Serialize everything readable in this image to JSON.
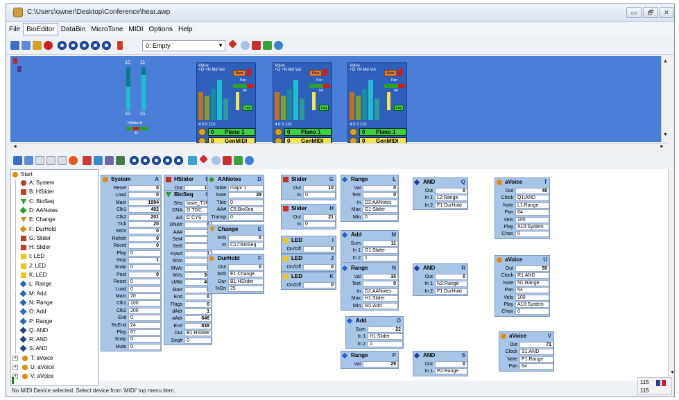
{
  "window": {
    "title": "C:\\Users\\owner\\Desktop\\Conference\\hear.awp",
    "min": "▭",
    "max": "🗗",
    "close": "✕"
  },
  "menu": [
    "File",
    "BioEditor",
    "DataBin",
    "MicroTone",
    "MIDI",
    "Options",
    "Help"
  ],
  "toolbar": {
    "preset": "0: Empty"
  },
  "rack": {
    "hslider": {
      "top_a": "10",
      "top_b": "11",
      "mid_a": "10",
      "mid_b": "21",
      "label": "HSlider H",
      "sub": "11",
      "levels": [
        0.55,
        0.82
      ]
    },
    "voices": [
      {
        "title": "Voice",
        "sub": "+O +N Md Vol",
        "mute": "Mute",
        "pan": "Pan",
        "pan_val": "64",
        "leg": "Leg",
        "nums": "4   0   0  110",
        "instrument_num": "0",
        "instrument": "Piano 1",
        "bank_num": "0",
        "bank": "GenMIDI"
      },
      {
        "title": "Voice",
        "sub": "+O +N Md Vol",
        "mute": "Mute",
        "pan": "Pan",
        "pan_val": "64",
        "leg": "Leg",
        "nums": "4   0   0  110",
        "instrument_num": "0",
        "instrument": "Piano 1",
        "bank_num": "0",
        "bank": "GenMIDI"
      },
      {
        "title": "Voice",
        "sub": "+O +N Md Vol",
        "mute": "Mute",
        "pan": "Pan",
        "pan_val": "64",
        "leg": "Leg",
        "nums": "4   0   0  110",
        "instrument_num": "0",
        "instrument": "Piano 1",
        "bank_num": "0",
        "bank": "GenMIDI"
      }
    ]
  },
  "tree": {
    "root": "Start",
    "items": [
      {
        "label": "A: System",
        "shape": "dot",
        "color": "#c0392b"
      },
      {
        "label": "B: HSlider",
        "shape": "sq",
        "color": "#c0392b"
      },
      {
        "label": "C: BioSeq",
        "shape": "tri",
        "color": "#2aa02a"
      },
      {
        "label": "D: AANotes",
        "shape": "dia",
        "color": "#2aa02a"
      },
      {
        "label": "E: Change",
        "shape": "tri",
        "color": "#e08a1a"
      },
      {
        "label": "F: DurHold",
        "shape": "dia",
        "color": "#e08a1a"
      },
      {
        "label": "G: Slider",
        "shape": "sq",
        "color": "#c0392b"
      },
      {
        "label": "H: Slider",
        "shape": "sq",
        "color": "#c0392b"
      },
      {
        "label": "I: LED",
        "shape": "sq",
        "color": "#e8c820"
      },
      {
        "label": "J: LED",
        "shape": "sq",
        "color": "#e8c820"
      },
      {
        "label": "K: LED",
        "shape": "sq",
        "color": "#e8c820"
      },
      {
        "label": "L: Range",
        "shape": "dia",
        "color": "#2a62c8"
      },
      {
        "label": "M: Add",
        "shape": "dia",
        "color": "#2a62c8"
      },
      {
        "label": "N: Range",
        "shape": "dia",
        "color": "#2a62c8"
      },
      {
        "label": "O: Add",
        "shape": "dia",
        "color": "#2a62c8"
      },
      {
        "label": "P: Range",
        "shape": "dia",
        "color": "#2a62c8"
      },
      {
        "label": "Q: AND",
        "shape": "dia",
        "color": "#1f3f9a"
      },
      {
        "label": "R: AND",
        "shape": "dia",
        "color": "#1f3f9a"
      },
      {
        "label": "S: AND",
        "shape": "dia",
        "color": "#1f3f9a"
      },
      {
        "label": "T: aVoice",
        "shape": "dot",
        "color": "#e08a1a",
        "expand": "+"
      },
      {
        "label": "U: aVoice",
        "shape": "dot",
        "color": "#e08a1a",
        "expand": "+"
      },
      {
        "label": "V: aVoice",
        "shape": "dot",
        "color": "#e08a1a",
        "expand": "+"
      }
    ]
  },
  "blocks": {
    "system": {
      "title": "System",
      "letter": "A",
      "rows": [
        [
          "Reset",
          "0"
        ],
        [
          "Load",
          "0"
        ],
        [
          "Main",
          "1994"
        ],
        [
          "Clk1",
          "402"
        ],
        [
          "Clk2",
          "201"
        ],
        [
          "Tick",
          "20"
        ],
        [
          "MIDI",
          "0"
        ],
        [
          "Refrsh",
          "0"
        ],
        [
          "Recrd",
          "0"
        ],
        [
          "Play",
          "0"
        ],
        [
          "Stop",
          "1"
        ],
        [
          "Snap",
          "0"
        ],
        [
          "Post",
          "0"
        ],
        [
          "Reset",
          "0"
        ],
        [
          "Load",
          "0"
        ],
        [
          "Main",
          "20"
        ],
        [
          "Clk1",
          "100"
        ],
        [
          "Clk2",
          "200"
        ],
        [
          "Exit",
          "0"
        ],
        [
          "RcEnd",
          "24"
        ],
        [
          "Play",
          "67"
        ],
        [
          "Snap",
          "0"
        ],
        [
          "Mute",
          "0"
        ]
      ]
    },
    "hslider": {
      "title": "HSlider",
      "letter": "B",
      "rows": [
        [
          "Out",
          "11"
        ],
        [
          "In",
          "0"
        ]
      ]
    },
    "bioseq": {
      "title": "BioSeq",
      "letter": "C",
      "rows": [
        [
          "Seq",
          "taste_T1R2"
        ],
        [
          "DNA",
          "G TGC"
        ],
        [
          "AA",
          "C CYS"
        ],
        [
          "DNA#",
          "0"
        ],
        [
          "AA#",
          "4"
        ],
        [
          "Set4",
          "2"
        ],
        [
          "Set6",
          "1"
        ],
        [
          "Kywd",
          "1"
        ],
        [
          "MVo",
          "3"
        ],
        [
          "MWo",
          "6"
        ],
        [
          "MVs",
          "39"
        ],
        [
          "sMW",
          "45"
        ],
        [
          "Start",
          "0"
        ],
        [
          "End",
          "0"
        ],
        [
          "Flags",
          "0"
        ],
        [
          "dAdr",
          "1"
        ],
        [
          "aAdr",
          "646"
        ],
        [
          "End",
          "838"
        ],
        [
          "Dur",
          "B1:HSlider"
        ],
        [
          "Seq#",
          "0"
        ]
      ]
    },
    "aanotes": {
      "title": "AANotes",
      "letter": "D",
      "rows": [
        [
          "Table",
          "major 1"
        ],
        [
          "Note",
          "29"
        ],
        [
          "Tble",
          "0"
        ],
        [
          "AA#",
          "C5:BioSeq"
        ],
        [
          "Transp",
          "0"
        ]
      ]
    },
    "change": {
      "title": "Change",
      "letter": "E",
      "rows": [
        [
          "Strb",
          "0"
        ],
        [
          "In",
          "C17:BioSeq"
        ]
      ]
    },
    "durhold": {
      "title": "DurHold",
      "letter": "F",
      "rows": [
        [
          "Out",
          "0"
        ],
        [
          "Strb",
          "E1:Change"
        ],
        [
          "Dur",
          "B1:HSlider"
        ],
        [
          "%On",
          "25"
        ]
      ]
    },
    "slider_g": {
      "title": "Slider",
      "letter": "G",
      "rows": [
        [
          "Out",
          "10"
        ],
        [
          "In",
          "0"
        ]
      ]
    },
    "slider_h": {
      "title": "Slider",
      "letter": "H",
      "rows": [
        [
          "Out",
          "21"
        ],
        [
          "In",
          "0"
        ]
      ]
    },
    "led_i": {
      "title": "LED",
      "letter": "I",
      "rows": [
        [
          "On/Off",
          "0"
        ]
      ]
    },
    "led_j": {
      "title": "LED",
      "letter": "J",
      "rows": [
        [
          "On/Off",
          "0"
        ]
      ]
    },
    "led_k": {
      "title": "LED",
      "letter": "K",
      "rows": [
        [
          "On/Off",
          "0"
        ]
      ]
    },
    "range_l": {
      "title": "Range",
      "letter": "L",
      "rows": [
        [
          "Val",
          "0"
        ],
        [
          "Test",
          "0"
        ],
        [
          "In",
          "D2:AANotes"
        ],
        [
          "Max",
          "G1:Slider"
        ],
        [
          "Min",
          "0"
        ]
      ]
    },
    "add_m": {
      "title": "Add",
      "letter": "M",
      "rows": [
        [
          "Sum",
          "11"
        ],
        [
          "In 1",
          "G1:Slider"
        ],
        [
          "In 2",
          "1"
        ]
      ]
    },
    "range_n": {
      "title": "Range",
      "letter": "N",
      "rows": [
        [
          "Val",
          "15"
        ],
        [
          "Test",
          "0"
        ],
        [
          "In",
          "D2:AANotes"
        ],
        [
          "Max",
          "H1:Slider"
        ],
        [
          "Min",
          "M1:Add"
        ]
      ]
    },
    "add_o": {
      "title": "Add",
      "letter": "O",
      "rows": [
        [
          "Sum",
          "22"
        ],
        [
          "In 1",
          "H1:Slider"
        ],
        [
          "In 2",
          "1"
        ]
      ]
    },
    "range_p": {
      "title": "Range",
      "letter": "P",
      "rows": [
        [
          "Val",
          "29"
        ]
      ]
    },
    "and_q": {
      "title": "AND",
      "letter": "Q",
      "rows": [
        [
          "Out",
          "0"
        ],
        [
          "In 1",
          "L2:Range"
        ],
        [
          "In 2",
          "F1:DurHold"
        ]
      ]
    },
    "and_r": {
      "title": "AND",
      "letter": "R",
      "rows": [
        [
          "Out",
          "0"
        ],
        [
          "In 1",
          "N2:Range"
        ],
        [
          "In 2",
          "F1:DurHold"
        ]
      ]
    },
    "and_s": {
      "title": "AND",
      "letter": "S",
      "rows": [
        [
          "Out",
          "0"
        ],
        [
          "In 1",
          "P2:Range"
        ]
      ]
    },
    "avoice_t": {
      "title": "aVoice",
      "letter": "T",
      "rows": [
        [
          "Out",
          "48"
        ],
        [
          "Clock",
          "Q1:AND"
        ],
        [
          "Note",
          "L1:Range"
        ],
        [
          "Pan",
          "64"
        ],
        [
          "Velo",
          "100"
        ],
        [
          "Play",
          "A10:System"
        ],
        [
          "Chan",
          "0"
        ]
      ]
    },
    "avoice_u": {
      "title": "aVoice",
      "letter": "U",
      "rows": [
        [
          "Out",
          "59"
        ],
        [
          "Clock",
          "R1:AND"
        ],
        [
          "Note",
          "N1:Range"
        ],
        [
          "Pan",
          "64"
        ],
        [
          "Velo",
          "100"
        ],
        [
          "Play",
          "A10:System"
        ],
        [
          "Chan",
          "0"
        ]
      ]
    },
    "avoice_v": {
      "title": "aVoice",
      "letter": "V",
      "rows": [
        [
          "Out",
          "71"
        ],
        [
          "Clock",
          "S1:AND"
        ],
        [
          "Note",
          "P1:Range"
        ],
        [
          "Pan",
          "64"
        ]
      ]
    }
  },
  "status": {
    "message": "No MIDI Device selected. Select device from 'MIDI' top menu item.",
    "count": "115",
    "count2": "115"
  }
}
